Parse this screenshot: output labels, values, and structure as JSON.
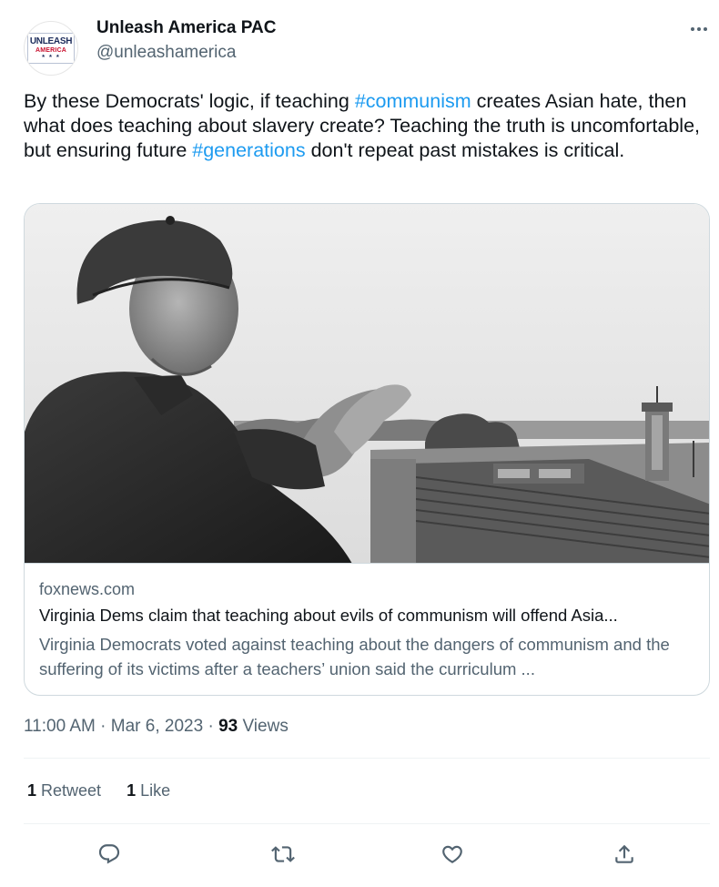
{
  "author": {
    "name": "Unleash America PAC",
    "handle": "@unleashamerica",
    "avatar": {
      "line1": "UNLEASH",
      "line2": "AMERICA",
      "stars": "★ ★ ★",
      "navy": "#1c2c5b",
      "red": "#c8102e"
    }
  },
  "tweet": {
    "segments": [
      {
        "text": "By these Democrats' logic, if teaching ",
        "type": "text"
      },
      {
        "text": "#communism",
        "type": "hashtag"
      },
      {
        "text": " creates Asian hate, then what does teaching about slavery create? Teaching the truth is uncomfortable, but ensuring future ",
        "type": "text"
      },
      {
        "text": "#generations",
        "type": "hashtag"
      },
      {
        "text": " don't repeat past mistakes is critical.",
        "type": "text"
      }
    ]
  },
  "card": {
    "image_icon": "black-and-white-photo-man-in-cap-clapping-over-crowd",
    "domain": "foxnews.com",
    "title": "Virginia Dems claim that teaching about evils of communism will offend Asia...",
    "description": "Virginia Democrats voted against teaching about the dangers of communism and the suffering of its victims after a teachers’ union said the curriculum ..."
  },
  "meta": {
    "time": "11:00 AM",
    "sep1": " · ",
    "date": "Mar 6, 2023",
    "sep2": " · ",
    "views_count": "93",
    "views_label": " Views"
  },
  "stats": {
    "retweets_count": "1",
    "retweets_label": " Retweet",
    "likes_count": "1",
    "likes_label": " Like"
  },
  "actions": [
    {
      "icon": "reply-icon"
    },
    {
      "icon": "retweet-icon"
    },
    {
      "icon": "like-icon"
    },
    {
      "icon": "share-icon"
    }
  ],
  "colors": {
    "text": "#0f1419",
    "secondary": "#536471",
    "link": "#1d9bf0",
    "border": "#cfd9de",
    "divider": "#eff3f4"
  }
}
